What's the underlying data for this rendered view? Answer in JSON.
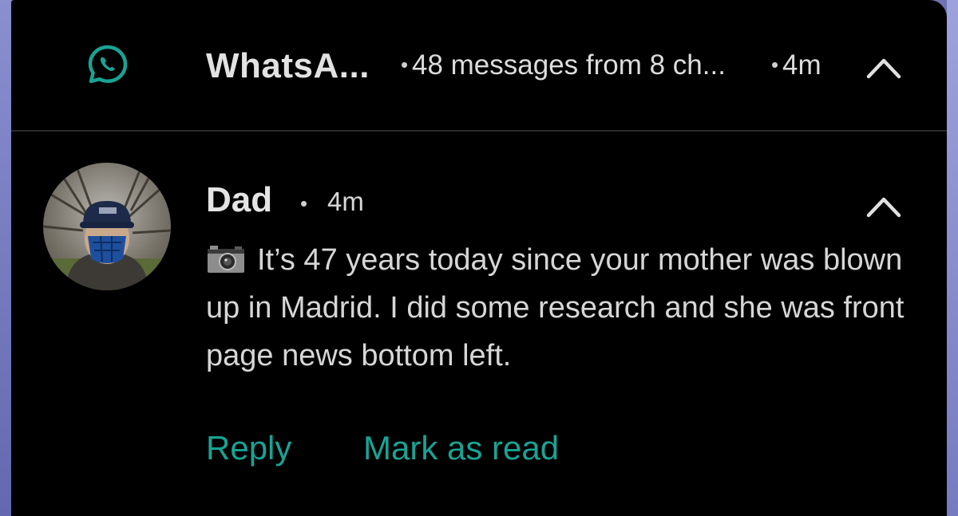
{
  "notification": {
    "app_name": "WhatsA...",
    "separator": "•",
    "summary": "48 messages from 8 ch...",
    "time": "4m",
    "message": {
      "sender": "Dad",
      "time": "4m",
      "media_icon": "camera-icon",
      "text": "It’s 47 years today since your mother was blown up in Madrid. I did some research and she was front page news bottom left."
    },
    "actions": {
      "reply_label": "Reply",
      "mark_read_label": "Mark as read"
    }
  },
  "colors": {
    "accent": "#19a394",
    "background": "#000000",
    "text": "#d6d6d6"
  },
  "icons": {
    "app": "whatsapp-icon",
    "collapse": "chevron-up-icon",
    "avatar": "avatar"
  }
}
